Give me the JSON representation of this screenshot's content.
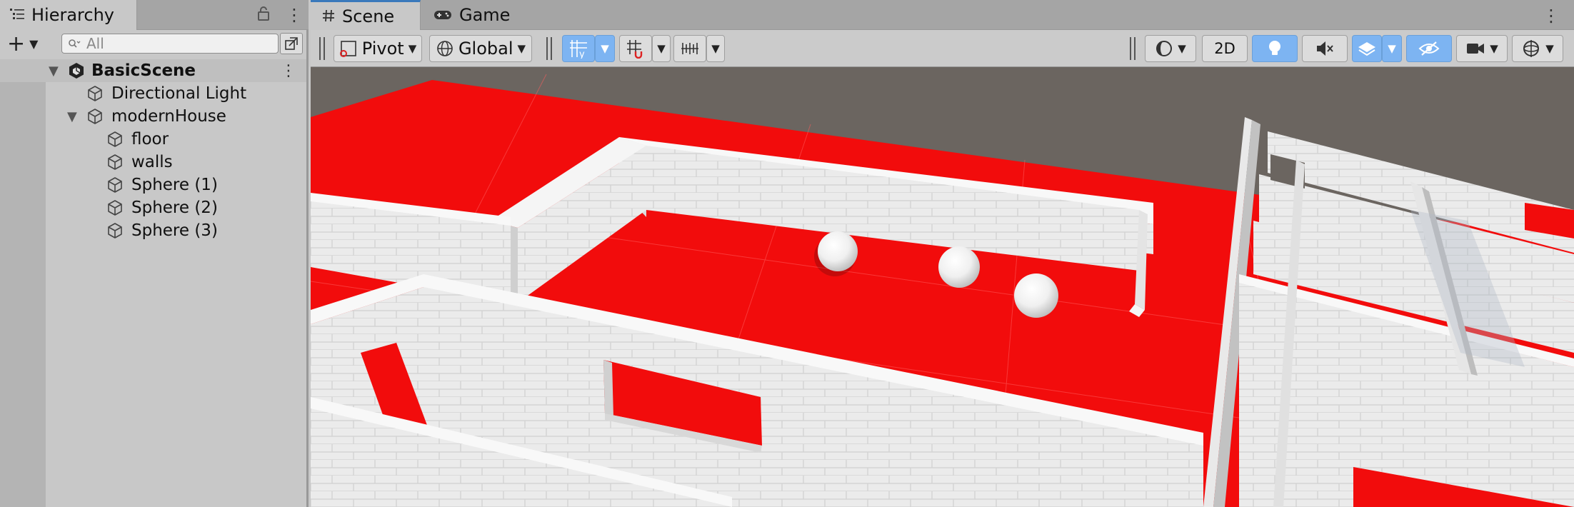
{
  "hierarchy": {
    "tab_label": "Hierarchy",
    "search_placeholder": "All",
    "scene_name": "BasicScene",
    "items": [
      {
        "label": "Directional Light"
      },
      {
        "label": "modernHouse"
      },
      {
        "label": "floor"
      },
      {
        "label": "walls"
      },
      {
        "label": "Sphere (1)"
      },
      {
        "label": "Sphere (2)"
      },
      {
        "label": "Sphere (3)"
      }
    ]
  },
  "scene": {
    "tabs": [
      {
        "label": "Scene"
      },
      {
        "label": "Game"
      }
    ],
    "toolbar": {
      "pivot_label": "Pivot",
      "global_label": "Global",
      "mode_2d_label": "2D"
    }
  },
  "icons": {
    "hierarchy_tab": "list-icon",
    "lock": "lock-icon",
    "menu": "kebab-menu-icon",
    "add": "plus-icon",
    "search": "search-icon",
    "scene_tab": "grid-hash-icon",
    "game_tab": "gamepad-icon",
    "scene_object": "unity-scene-icon",
    "game_object": "cube-icon"
  },
  "colors": {
    "floor": "#f20c0c",
    "sky": "#6b6560",
    "wall": "#e9e9e9",
    "toggle_active": "#7db4f2",
    "tab_accent": "#3a79bb"
  }
}
